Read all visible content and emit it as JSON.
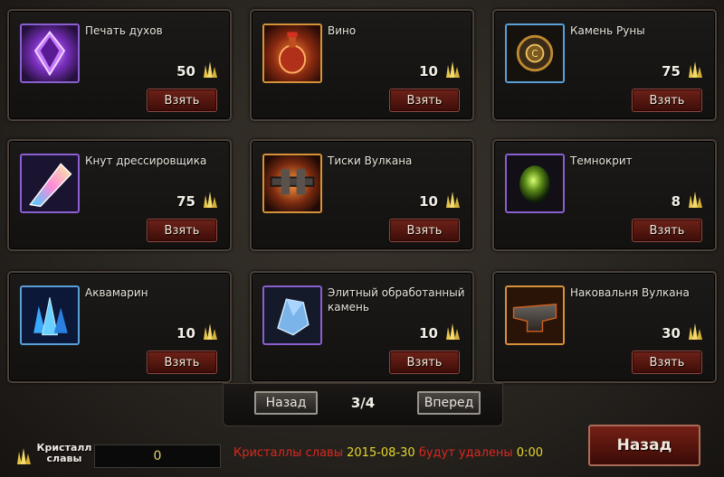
{
  "items": [
    {
      "name": "Печать духов",
      "qty": "50",
      "button": "Взять",
      "icon": "spirit-seal-icon",
      "frame": "#8a5fd1"
    },
    {
      "name": "Вино",
      "qty": "10",
      "button": "Взять",
      "icon": "wine-icon",
      "frame": "#d59238"
    },
    {
      "name": "Камень Руны",
      "qty": "75",
      "button": "Взять",
      "icon": "rune-stone-icon",
      "frame": "#5aa0d8"
    },
    {
      "name": "Кнут дрессировщика",
      "qty": "75",
      "button": "Взять",
      "icon": "trainer-whip-icon",
      "frame": "#8a5fd1"
    },
    {
      "name": "Тиски Вулкана",
      "qty": "10",
      "button": "Взять",
      "icon": "vulcan-vise-icon",
      "frame": "#d59238"
    },
    {
      "name": "Темнокрит",
      "qty": "8",
      "button": "Взять",
      "icon": "darkcrit-icon",
      "frame": "#8a5fd1"
    },
    {
      "name": "Аквамарин",
      "qty": "10",
      "button": "Взять",
      "icon": "aquamarine-icon",
      "frame": "#5aa0d8"
    },
    {
      "name": "Элитный обработанный камень",
      "qty": "10",
      "button": "Взять",
      "icon": "elite-stone-icon",
      "frame": "#8a5fd1"
    },
    {
      "name": "Наковальня Вулкана",
      "qty": "30",
      "button": "Взять",
      "icon": "vulcan-anvil-icon",
      "frame": "#d59238"
    }
  ],
  "pager": {
    "prev": "Назад",
    "page": "3/4",
    "next": "Вперед"
  },
  "footer": {
    "crystal_label": "Кристалл славы",
    "crystal_value": "0",
    "status_label": "Кристаллы славы",
    "status_date": "2015-08-30",
    "status_suffix": "будут удалены",
    "status_value": "0:00",
    "back_button": "Назад"
  },
  "colors": {
    "accent_red": "#6e2218",
    "gold": "#e8c64a"
  }
}
